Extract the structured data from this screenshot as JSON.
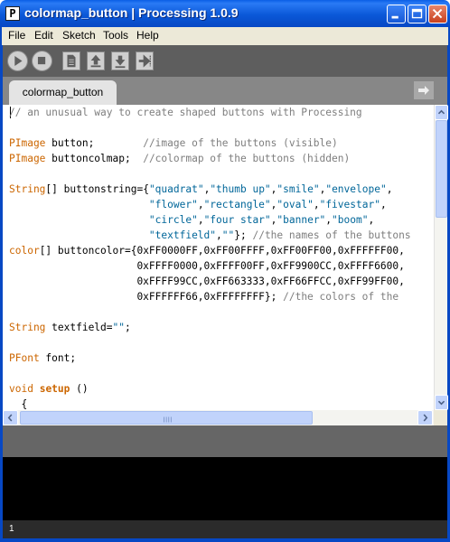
{
  "window": {
    "title": "colormap_button | Processing 1.0.9",
    "app_icon_glyph": "P"
  },
  "menu": {
    "items": [
      {
        "label": "File"
      },
      {
        "label": "Edit"
      },
      {
        "label": "Sketch"
      },
      {
        "label": "Tools"
      },
      {
        "label": "Help"
      }
    ]
  },
  "toolbar": {
    "buttons": [
      "run-icon",
      "stop-icon",
      "new-icon",
      "open-icon",
      "save-icon",
      "export-icon"
    ]
  },
  "tabs": {
    "active_label": "colormap_button"
  },
  "editor": {
    "lines": [
      "// an unusual way to create shaped buttons with Processing",
      "",
      "PImage button;        //image of the buttons (visible)",
      "PImage buttoncolmap;  //colormap of the buttons (hidden)",
      "",
      "String[] buttonstring={\"quadrat\",\"thumb up\",\"smile\",\"envelope\",",
      "                       \"flower\",\"rectangle\",\"oval\",\"fivestar\",",
      "                       \"circle\",\"four star\",\"banner\",\"boom\",",
      "                       \"textfield\",\"\"}; //the names of the buttons",
      "color[] buttoncolor={0xFF0000FF,0xFF00FFFF,0xFF00FF00,0xFFFFFF00,",
      "                     0xFFFF0000,0xFFFF00FF,0xFF9900CC,0xFFFF6600,",
      "                     0xFFFF99CC,0xFF663333,0xFF66FFCC,0xFF99FF00,",
      "                     0xFFFFFF66,0xFFFFFFFF}; //the colors of the",
      "",
      "String textfield=\"\";",
      "",
      "PFont font;",
      "",
      "void setup ()",
      "  {"
    ]
  },
  "status": {
    "line_number": "1"
  },
  "colors": {
    "titlebar": "#0a58d8",
    "toolbar": "#5e5e5e",
    "tabstrip": "#878787",
    "message_area": "#666666",
    "console": "#000000",
    "keyword": "#cc6600",
    "string": "#006699",
    "comment": "#7e7e7e"
  }
}
